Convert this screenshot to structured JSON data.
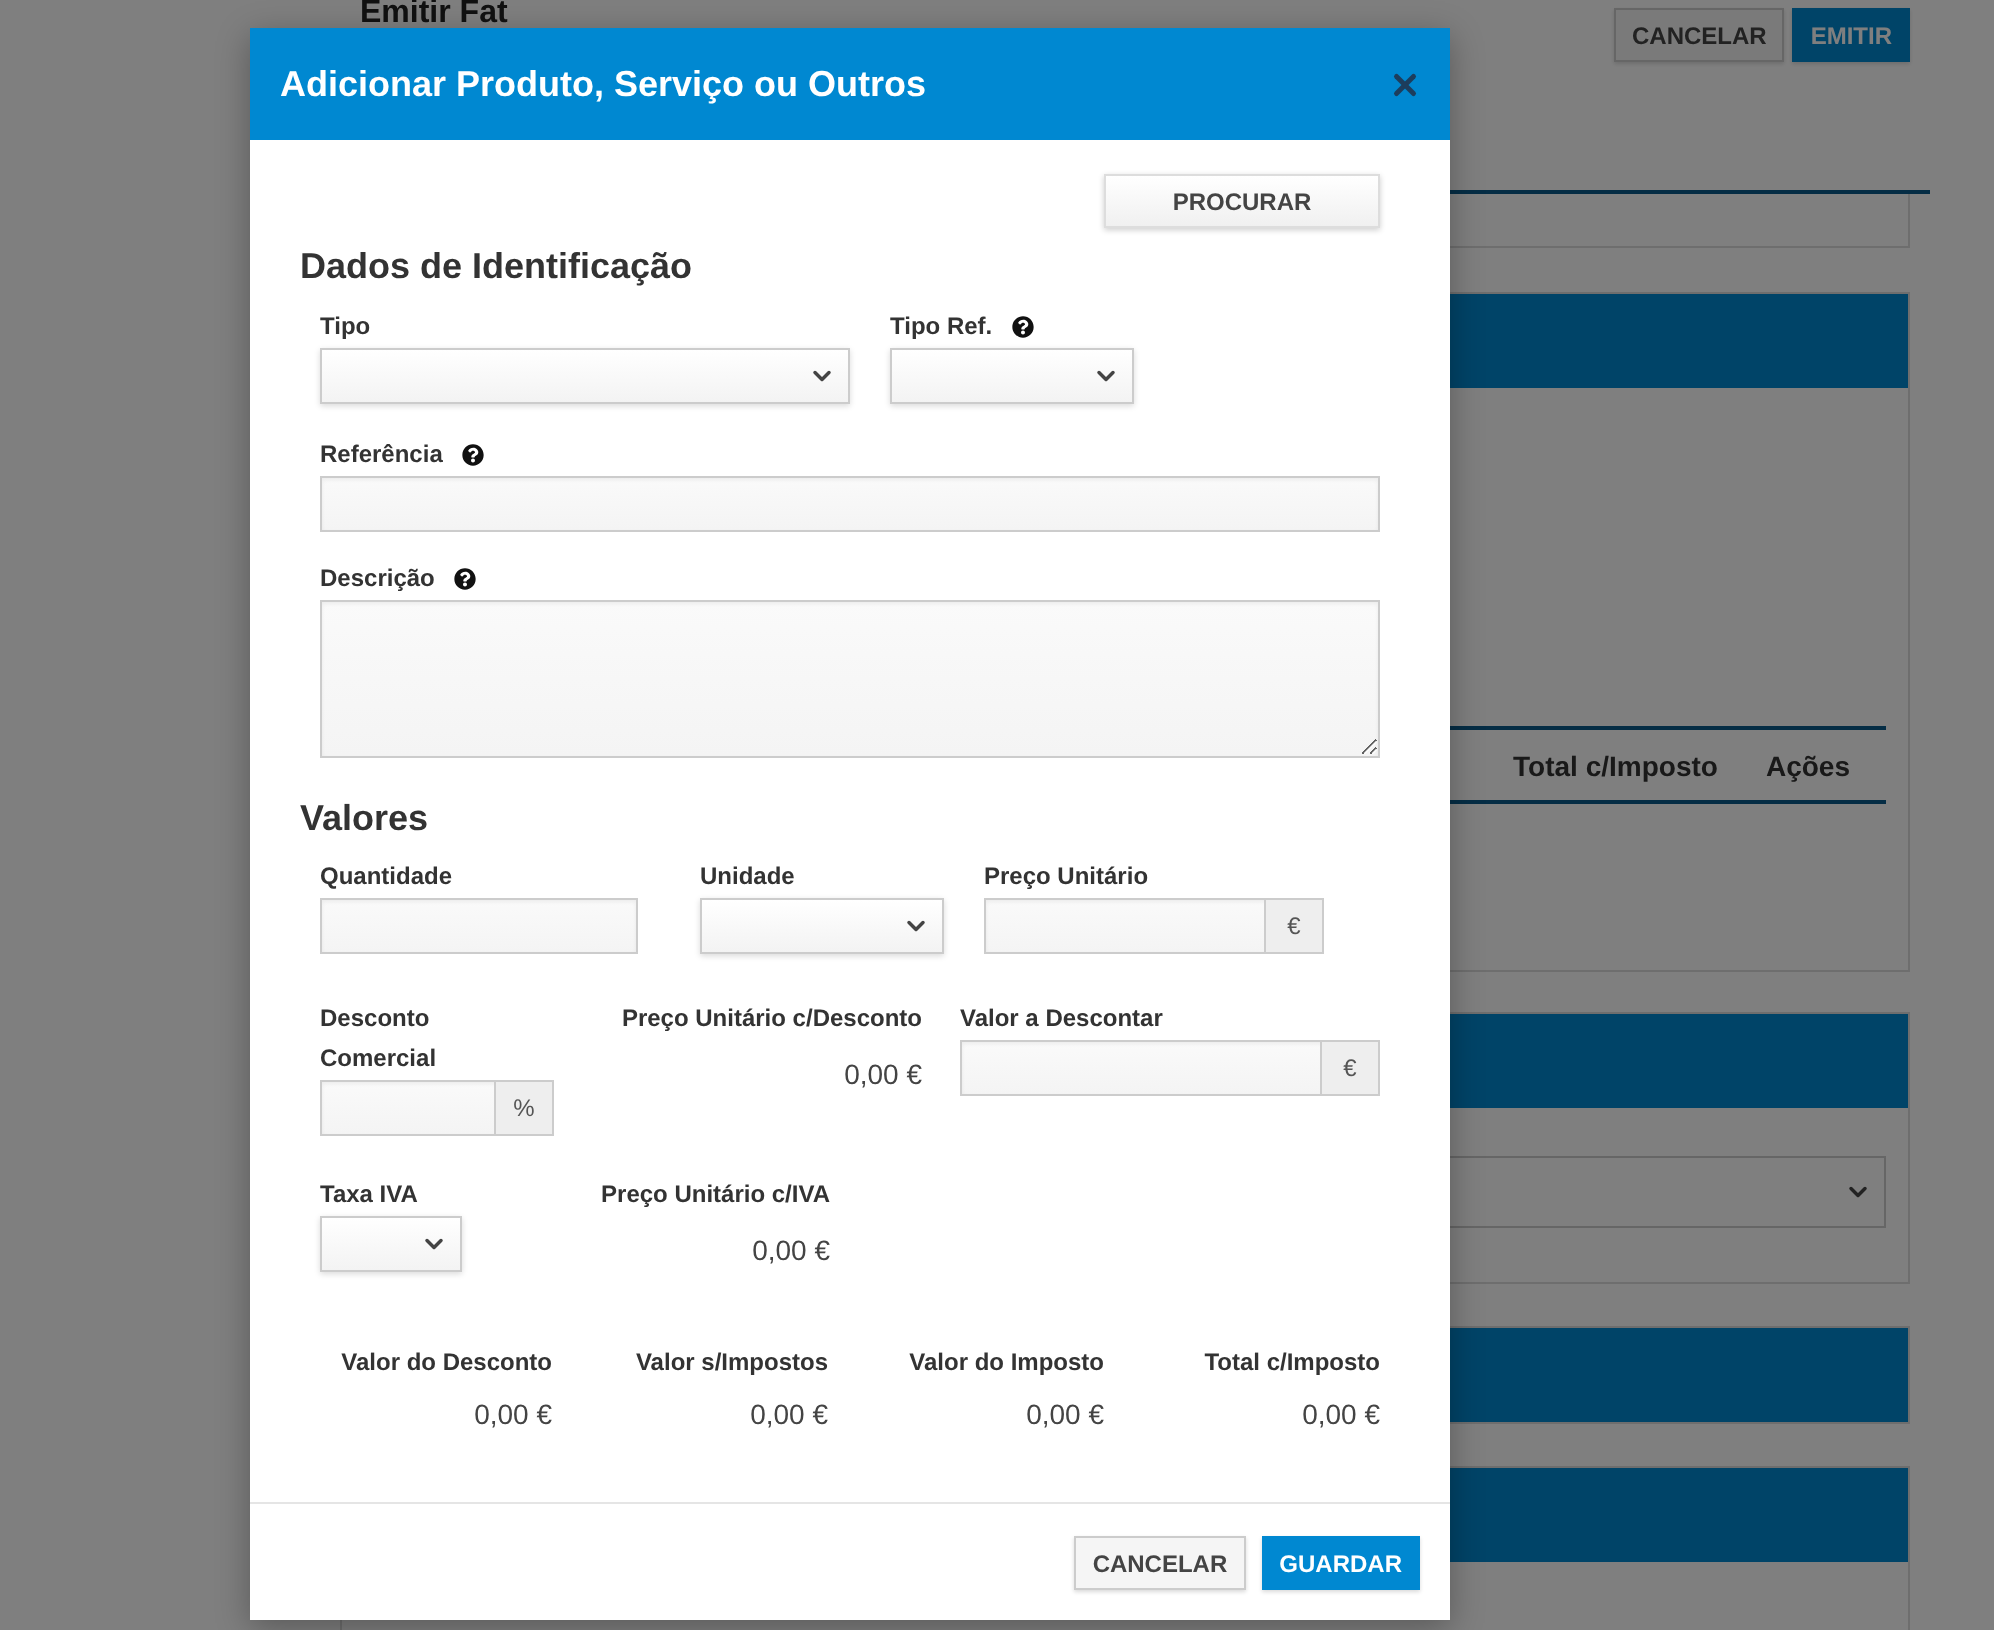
{
  "page": {
    "title": "Emitir Fat",
    "buttons": [
      {
        "label": "CANCELAR",
        "kind": "secondary"
      },
      {
        "label": "EMITIR",
        "kind": "primary"
      }
    ],
    "table_columns": [
      "Total c/Imposto",
      "Ações"
    ]
  },
  "modal": {
    "title": "Adicionar Produto, Serviço ou Outros",
    "search_button": "PROCURAR",
    "identification": {
      "heading": "Dados de Identificação",
      "rows": [
        [
          {
            "label": "Tipo",
            "kind": "select",
            "help": false
          },
          {
            "label": "Tipo Ref.",
            "kind": "select",
            "help": true
          }
        ],
        [
          {
            "label": "Referência",
            "kind": "input",
            "help": true
          }
        ],
        [
          {
            "label": "Descrição",
            "kind": "textarea",
            "help": true
          }
        ]
      ]
    },
    "values": {
      "heading": "Valores",
      "rows": [
        [
          {
            "label": "Quantidade",
            "kind": "input"
          },
          {
            "label": "Unidade",
            "kind": "select"
          },
          {
            "label": "Preço Unitário",
            "kind": "addon",
            "addon": "€"
          }
        ],
        [
          {
            "label": "Desconto Comercial",
            "kind": "addon",
            "addon": "%"
          },
          {
            "label": "Preço Unitário c/Desconto",
            "kind": "readout",
            "value": "0,00 €"
          },
          {
            "label": "Valor a Descontar",
            "kind": "addon",
            "addon": "€"
          }
        ],
        [
          {
            "label": "Taxa IVA",
            "kind": "select"
          },
          {
            "label": "Preço Unitário c/IVA",
            "kind": "readout",
            "value": "0,00 €"
          }
        ]
      ]
    },
    "totals": [
      {
        "label": "Valor do Desconto",
        "value": "0,00 €"
      },
      {
        "label": "Valor s/Impostos",
        "value": "0,00 €"
      },
      {
        "label": "Valor do Imposto",
        "value": "0,00 €"
      },
      {
        "label": "Total c/Imposto",
        "value": "0,00 €"
      }
    ],
    "footer_buttons": [
      {
        "label": "CANCELAR",
        "kind": "secondary"
      },
      {
        "label": "GUARDAR",
        "kind": "primary"
      }
    ]
  }
}
